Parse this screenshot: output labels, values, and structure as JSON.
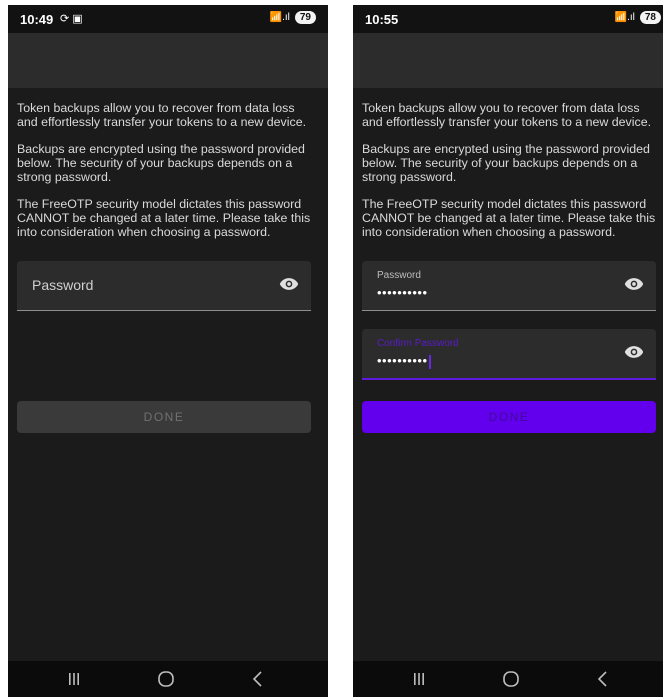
{
  "left_screen": {
    "status": {
      "time": "10:49",
      "left_icons": "⟳ ▣",
      "signal": "📶.ıl",
      "battery": "79"
    },
    "intro": [
      "Token backups allow you to recover from data loss and effortlessly transfer your tokens to a new device.",
      "Backups are encrypted using the password provided below. The security of your backups depends on a strong password.",
      "The FreeOTP security model dictates this password CANNOT be changed at a later time. Please take this into consideration when choosing a password."
    ],
    "password_field": {
      "label": "Password",
      "value": ""
    },
    "done_label": "DONE"
  },
  "right_screen": {
    "status": {
      "time": "10:55",
      "signal": "📶.ıl",
      "battery": "78"
    },
    "intro": [
      "Token backups allow you to recover from data loss and effortlessly transfer your tokens to a new device.",
      "Backups are encrypted using the password provided below. The security of your backups depends on a strong password.",
      "The FreeOTP security model dictates this password CANNOT be changed at a later time. Please take this into consideration when choosing a password."
    ],
    "password_field": {
      "label": "Password",
      "value": "••••••••••"
    },
    "confirm_field": {
      "label": "Confirm Password",
      "value": "••••••••••"
    },
    "done_label": "DONE"
  },
  "icons": {
    "eye": "eye-icon",
    "nav_recents": "recents-icon",
    "nav_home": "home-icon",
    "nav_back": "back-icon"
  },
  "colors": {
    "accent": "#6200ee",
    "background": "#1b1b1b",
    "field_bg": "#2c2c2c",
    "disabled_button": "#3a3a3a"
  }
}
